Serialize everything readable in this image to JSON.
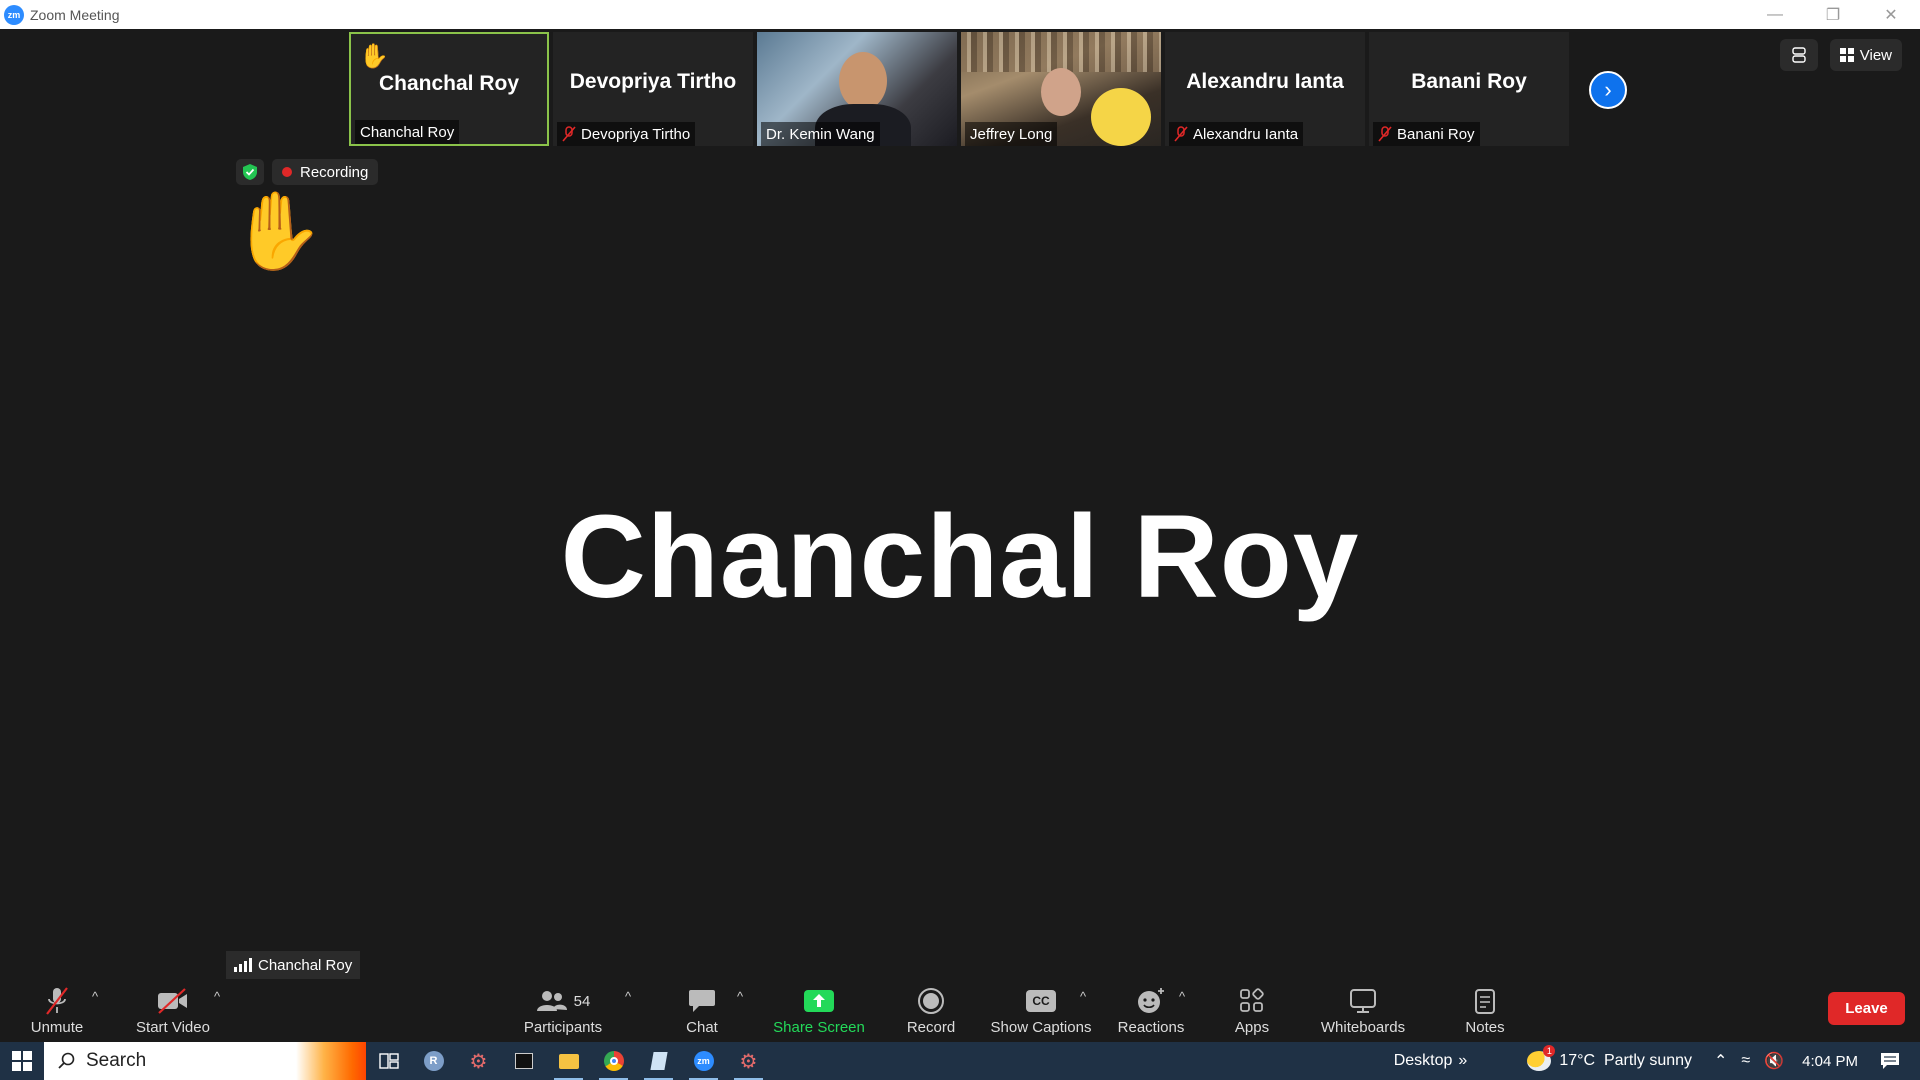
{
  "window": {
    "title": "Zoom Meeting",
    "logo_text": "zm"
  },
  "gallery": {
    "tiles": [
      {
        "display_name": "Chanchal Roy",
        "label": "Chanchal Roy",
        "muted": false,
        "hand_raised": true,
        "video": false
      },
      {
        "display_name": "Devopriya Tirtho",
        "label": "Devopriya Tirtho",
        "muted": true,
        "video": false
      },
      {
        "display_name": "",
        "label": "Dr. Kemin Wang",
        "muted": false,
        "video": true
      },
      {
        "display_name": "",
        "label": "Jeffrey Long",
        "muted": false,
        "video": true
      },
      {
        "display_name": "Alexandru Ianta",
        "label": "Alexandru Ianta",
        "muted": true,
        "video": false
      },
      {
        "display_name": "Banani Roy",
        "label": "Banani Roy",
        "muted": true,
        "video": false
      }
    ]
  },
  "top_right": {
    "view_label": "View"
  },
  "status": {
    "recording_label": "Recording"
  },
  "active_speaker": {
    "name": "Chanchal Roy",
    "tag": "Chanchal Roy"
  },
  "toolbar": {
    "unmute": "Unmute",
    "start_video": "Start Video",
    "participants": "Participants",
    "participants_count": "54",
    "chat": "Chat",
    "share_screen": "Share Screen",
    "record": "Record",
    "show_captions": "Show Captions",
    "captions_icon": "CC",
    "reactions": "Reactions",
    "apps": "Apps",
    "whiteboards": "Whiteboards",
    "notes": "Notes",
    "leave": "Leave"
  },
  "colors": {
    "accent": "#0e72ed",
    "leave": "#e02828",
    "share": "#23d959",
    "active_border": "#8bc34a"
  },
  "taskbar": {
    "search_placeholder": "Search",
    "desktop_label": "Desktop",
    "weather": "17°C  Partly sunny",
    "weather_badge": "1",
    "time": "4:04 PM"
  }
}
